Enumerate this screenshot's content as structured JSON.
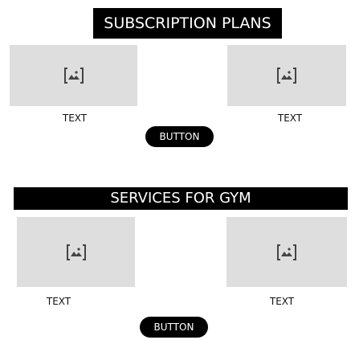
{
  "subscription": {
    "title": "SUBSCRIPTION PLANS",
    "left_caption": "TEXT",
    "right_caption": "TEXT",
    "button_label": "BUTTON",
    "left_image_icon": "image-placeholder-icon",
    "right_image_icon": "image-placeholder-icon"
  },
  "services": {
    "title": "SERVICES FOR GYM",
    "left_caption": "TEXT",
    "right_caption": "TEXT",
    "button_label": "BUTTON",
    "left_image_icon": "image-placeholder-icon",
    "right_image_icon": "image-placeholder-icon"
  },
  "colors": {
    "title_background": "#000000",
    "title_text": "#ffffff",
    "placeholder_fill": "#dedede",
    "button_background": "#000000",
    "button_text": "#ffffff",
    "icon_stroke": "#444444"
  }
}
